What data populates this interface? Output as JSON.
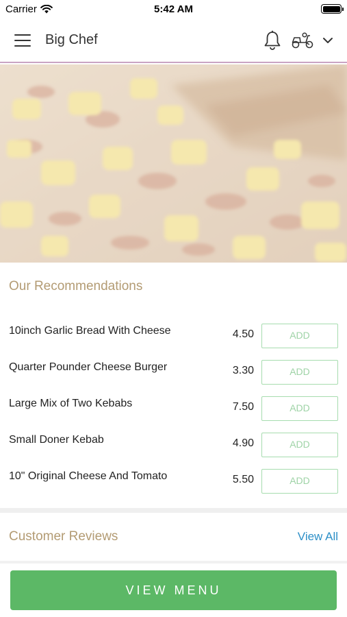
{
  "status_bar": {
    "carrier": "Carrier",
    "time": "5:42 AM"
  },
  "header": {
    "title": "Big Chef"
  },
  "recommendations": {
    "title": "Our Recommendations",
    "items": [
      {
        "name": "10inch Garlic Bread With Cheese",
        "price": "4.50",
        "add_label": "ADD"
      },
      {
        "name": "Quarter Pounder Cheese Burger",
        "price": "3.30",
        "add_label": "ADD"
      },
      {
        "name": "Large Mix of Two Kebabs",
        "price": "7.50",
        "add_label": "ADD"
      },
      {
        "name": "Small Doner Kebab",
        "price": "4.90",
        "add_label": "ADD"
      },
      {
        "name": "10\" Original Cheese And Tomato",
        "price": "5.50",
        "add_label": "ADD"
      }
    ]
  },
  "reviews": {
    "title": "Customer Reviews",
    "view_all": "View All"
  },
  "footer": {
    "view_menu": "VIEW MENU"
  },
  "colors": {
    "accent_green": "#5cb866",
    "section_title": "#b39b73",
    "link_blue": "#2c8fc7",
    "header_border": "#c9a4c3"
  },
  "icons": [
    "wifi-icon",
    "battery-icon",
    "hamburger-menu-icon",
    "bell-icon",
    "delivery-scooter-icon",
    "chevron-down-icon"
  ]
}
